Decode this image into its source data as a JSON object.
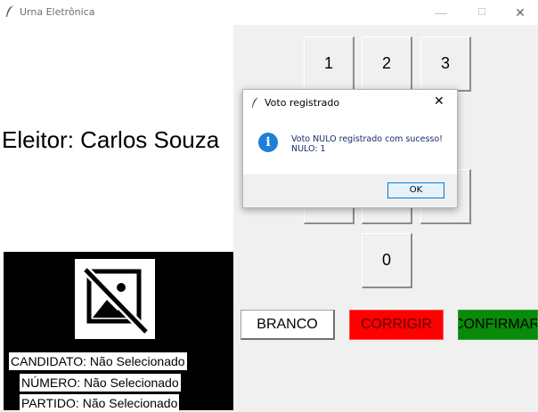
{
  "window": {
    "title": "Urna Eletrônica",
    "minimize": "—",
    "maximize": "☐",
    "close": "✕"
  },
  "voter": {
    "label": "Eleitor: Carlos Souza"
  },
  "candidate": {
    "name_line": "CANDIDATO: Não Selecionado",
    "number_line": "NÚMERO: Não Selecionado",
    "party_line": "PARTIDO: Não Selecionado",
    "image": "no-image-icon"
  },
  "keypad": {
    "k1": "1",
    "k2": "2",
    "k3": "3",
    "k0": "0"
  },
  "actions": {
    "branco": "BRANCO",
    "corrigir": "CORRIGIR",
    "confirmar": "CONFIRMAR"
  },
  "dialog": {
    "title": "Voto registrado",
    "message_line1": "Voto NULO registrado com sucesso!",
    "message_line2": "NULO: 1",
    "ok_label": "OK",
    "close": "✕",
    "icon": "info-icon"
  },
  "colors": {
    "corrigir_bg": "#ff0000",
    "confirmar_bg": "#0a8a0a",
    "info_icon": "#1e7ed8"
  }
}
